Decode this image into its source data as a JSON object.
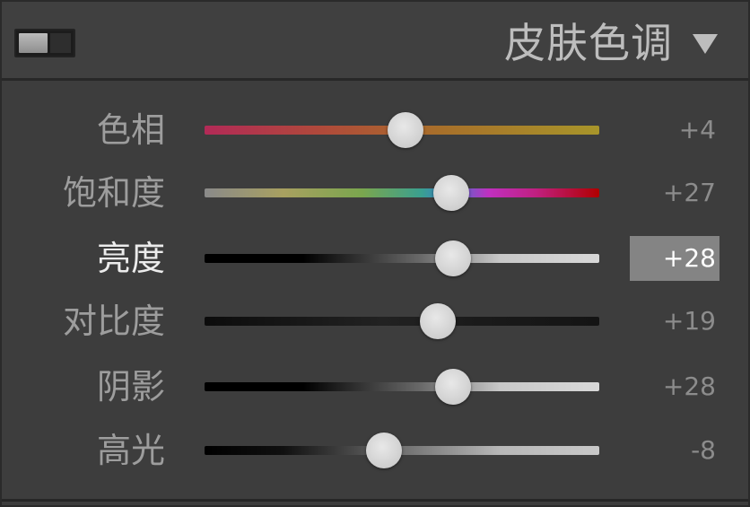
{
  "panel": {
    "title": "皮肤色调",
    "toggle_icon": "panel-toggle-switch",
    "collapse_icon": "triangle-down-icon"
  },
  "sliders": [
    {
      "label": "色相",
      "value": "+4",
      "position": 0.51,
      "active": false,
      "track": "linear-gradient(to right, #b22a57 0%, #b04a3a 30%, #a8702a 60%, #a8952a 100%)"
    },
    {
      "label": "饱和度",
      "value": "+27",
      "position": 0.625,
      "active": false,
      "track": "linear-gradient(to right, #8a8a8a 0%, #a8a060 20%, #7aa64e 40%, #3aa090 55%, #3a78d0 62%, #c030c0 72%, #c02080 84%, #b00000 100%)"
    },
    {
      "label": "亮度",
      "value": "+28",
      "position": 0.63,
      "active": true,
      "track": "linear-gradient(to right, #000000 0%, #000000 25%, #6a6a6a 55%, #c8c8c8 75%, #d8d8d8 100%)"
    },
    {
      "label": "对比度",
      "value": "+19",
      "position": 0.59,
      "active": false,
      "track": "linear-gradient(to right, #0c0c0c 0%, #222222 45%, #1a1a1a 70%, #141414 100%)"
    },
    {
      "label": "阴影",
      "value": "+28",
      "position": 0.63,
      "active": false,
      "track": "linear-gradient(to right, #000000 0%, #000000 25%, #6a6a6a 55%, #c8c8c8 75%, #d8d8d8 100%)"
    },
    {
      "label": "高光",
      "value": "-8",
      "position": 0.455,
      "active": false,
      "track": "linear-gradient(to right, #000000 0%, #101010 20%, #707070 50%, #b8b8b8 75%, #c8c8c8 100%)"
    }
  ],
  "colors": {
    "background": "#3d3d3d",
    "label_inactive": "#9d9d9d",
    "label_active": "#ececec",
    "value_text": "#8c8c8c",
    "value_box": "#848484"
  }
}
